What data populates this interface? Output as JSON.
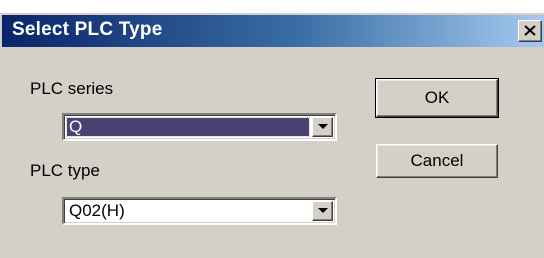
{
  "window": {
    "title": "Select PLC Type",
    "close_label": "close"
  },
  "form": {
    "series_label": "PLC series",
    "series_value": "Q",
    "type_label": "PLC type",
    "type_value": "Q02(H)"
  },
  "buttons": {
    "ok_label": "OK",
    "cancel_label": "Cancel"
  },
  "icons": {
    "close": "close-icon",
    "dropdown": "chevron-down-icon"
  },
  "colors": {
    "title_gradient_start": "#0a246a",
    "title_gradient_end": "#a6caf0",
    "dialog_background": "#d4d0c8",
    "selection_highlight": "#4a4272"
  }
}
